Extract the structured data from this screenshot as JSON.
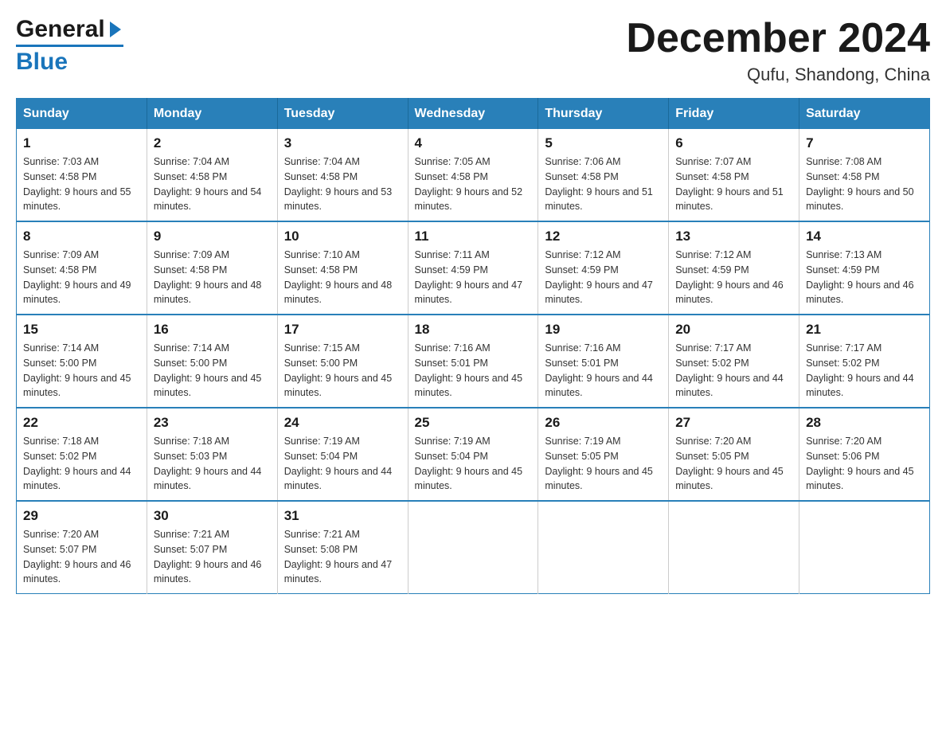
{
  "header": {
    "logo_general": "General",
    "logo_triangle": "▶",
    "logo_blue": "Blue",
    "month_title": "December 2024",
    "location": "Qufu, Shandong, China"
  },
  "calendar": {
    "days_of_week": [
      "Sunday",
      "Monday",
      "Tuesday",
      "Wednesday",
      "Thursday",
      "Friday",
      "Saturday"
    ],
    "weeks": [
      [
        {
          "day": "1",
          "sunrise": "Sunrise: 7:03 AM",
          "sunset": "Sunset: 4:58 PM",
          "daylight": "Daylight: 9 hours and 55 minutes."
        },
        {
          "day": "2",
          "sunrise": "Sunrise: 7:04 AM",
          "sunset": "Sunset: 4:58 PM",
          "daylight": "Daylight: 9 hours and 54 minutes."
        },
        {
          "day": "3",
          "sunrise": "Sunrise: 7:04 AM",
          "sunset": "Sunset: 4:58 PM",
          "daylight": "Daylight: 9 hours and 53 minutes."
        },
        {
          "day": "4",
          "sunrise": "Sunrise: 7:05 AM",
          "sunset": "Sunset: 4:58 PM",
          "daylight": "Daylight: 9 hours and 52 minutes."
        },
        {
          "day": "5",
          "sunrise": "Sunrise: 7:06 AM",
          "sunset": "Sunset: 4:58 PM",
          "daylight": "Daylight: 9 hours and 51 minutes."
        },
        {
          "day": "6",
          "sunrise": "Sunrise: 7:07 AM",
          "sunset": "Sunset: 4:58 PM",
          "daylight": "Daylight: 9 hours and 51 minutes."
        },
        {
          "day": "7",
          "sunrise": "Sunrise: 7:08 AM",
          "sunset": "Sunset: 4:58 PM",
          "daylight": "Daylight: 9 hours and 50 minutes."
        }
      ],
      [
        {
          "day": "8",
          "sunrise": "Sunrise: 7:09 AM",
          "sunset": "Sunset: 4:58 PM",
          "daylight": "Daylight: 9 hours and 49 minutes."
        },
        {
          "day": "9",
          "sunrise": "Sunrise: 7:09 AM",
          "sunset": "Sunset: 4:58 PM",
          "daylight": "Daylight: 9 hours and 48 minutes."
        },
        {
          "day": "10",
          "sunrise": "Sunrise: 7:10 AM",
          "sunset": "Sunset: 4:58 PM",
          "daylight": "Daylight: 9 hours and 48 minutes."
        },
        {
          "day": "11",
          "sunrise": "Sunrise: 7:11 AM",
          "sunset": "Sunset: 4:59 PM",
          "daylight": "Daylight: 9 hours and 47 minutes."
        },
        {
          "day": "12",
          "sunrise": "Sunrise: 7:12 AM",
          "sunset": "Sunset: 4:59 PM",
          "daylight": "Daylight: 9 hours and 47 minutes."
        },
        {
          "day": "13",
          "sunrise": "Sunrise: 7:12 AM",
          "sunset": "Sunset: 4:59 PM",
          "daylight": "Daylight: 9 hours and 46 minutes."
        },
        {
          "day": "14",
          "sunrise": "Sunrise: 7:13 AM",
          "sunset": "Sunset: 4:59 PM",
          "daylight": "Daylight: 9 hours and 46 minutes."
        }
      ],
      [
        {
          "day": "15",
          "sunrise": "Sunrise: 7:14 AM",
          "sunset": "Sunset: 5:00 PM",
          "daylight": "Daylight: 9 hours and 45 minutes."
        },
        {
          "day": "16",
          "sunrise": "Sunrise: 7:14 AM",
          "sunset": "Sunset: 5:00 PM",
          "daylight": "Daylight: 9 hours and 45 minutes."
        },
        {
          "day": "17",
          "sunrise": "Sunrise: 7:15 AM",
          "sunset": "Sunset: 5:00 PM",
          "daylight": "Daylight: 9 hours and 45 minutes."
        },
        {
          "day": "18",
          "sunrise": "Sunrise: 7:16 AM",
          "sunset": "Sunset: 5:01 PM",
          "daylight": "Daylight: 9 hours and 45 minutes."
        },
        {
          "day": "19",
          "sunrise": "Sunrise: 7:16 AM",
          "sunset": "Sunset: 5:01 PM",
          "daylight": "Daylight: 9 hours and 44 minutes."
        },
        {
          "day": "20",
          "sunrise": "Sunrise: 7:17 AM",
          "sunset": "Sunset: 5:02 PM",
          "daylight": "Daylight: 9 hours and 44 minutes."
        },
        {
          "day": "21",
          "sunrise": "Sunrise: 7:17 AM",
          "sunset": "Sunset: 5:02 PM",
          "daylight": "Daylight: 9 hours and 44 minutes."
        }
      ],
      [
        {
          "day": "22",
          "sunrise": "Sunrise: 7:18 AM",
          "sunset": "Sunset: 5:02 PM",
          "daylight": "Daylight: 9 hours and 44 minutes."
        },
        {
          "day": "23",
          "sunrise": "Sunrise: 7:18 AM",
          "sunset": "Sunset: 5:03 PM",
          "daylight": "Daylight: 9 hours and 44 minutes."
        },
        {
          "day": "24",
          "sunrise": "Sunrise: 7:19 AM",
          "sunset": "Sunset: 5:04 PM",
          "daylight": "Daylight: 9 hours and 44 minutes."
        },
        {
          "day": "25",
          "sunrise": "Sunrise: 7:19 AM",
          "sunset": "Sunset: 5:04 PM",
          "daylight": "Daylight: 9 hours and 45 minutes."
        },
        {
          "day": "26",
          "sunrise": "Sunrise: 7:19 AM",
          "sunset": "Sunset: 5:05 PM",
          "daylight": "Daylight: 9 hours and 45 minutes."
        },
        {
          "day": "27",
          "sunrise": "Sunrise: 7:20 AM",
          "sunset": "Sunset: 5:05 PM",
          "daylight": "Daylight: 9 hours and 45 minutes."
        },
        {
          "day": "28",
          "sunrise": "Sunrise: 7:20 AM",
          "sunset": "Sunset: 5:06 PM",
          "daylight": "Daylight: 9 hours and 45 minutes."
        }
      ],
      [
        {
          "day": "29",
          "sunrise": "Sunrise: 7:20 AM",
          "sunset": "Sunset: 5:07 PM",
          "daylight": "Daylight: 9 hours and 46 minutes."
        },
        {
          "day": "30",
          "sunrise": "Sunrise: 7:21 AM",
          "sunset": "Sunset: 5:07 PM",
          "daylight": "Daylight: 9 hours and 46 minutes."
        },
        {
          "day": "31",
          "sunrise": "Sunrise: 7:21 AM",
          "sunset": "Sunset: 5:08 PM",
          "daylight": "Daylight: 9 hours and 47 minutes."
        },
        {
          "day": "",
          "sunrise": "",
          "sunset": "",
          "daylight": ""
        },
        {
          "day": "",
          "sunrise": "",
          "sunset": "",
          "daylight": ""
        },
        {
          "day": "",
          "sunrise": "",
          "sunset": "",
          "daylight": ""
        },
        {
          "day": "",
          "sunrise": "",
          "sunset": "",
          "daylight": ""
        }
      ]
    ]
  }
}
